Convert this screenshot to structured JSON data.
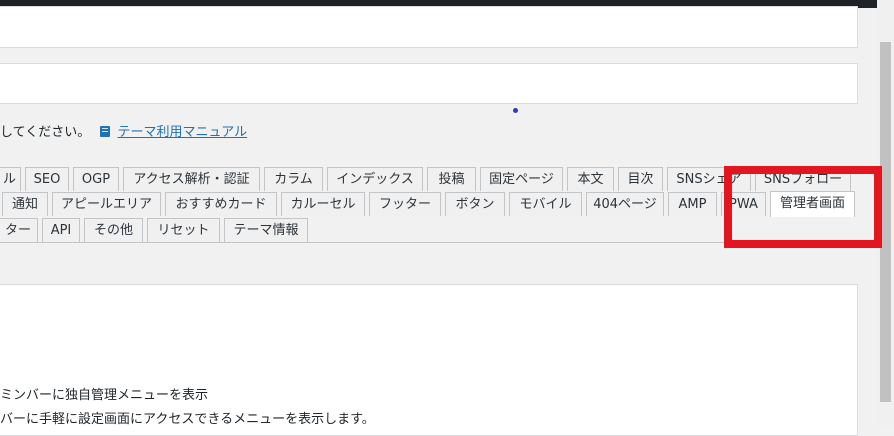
{
  "description": {
    "text": "してください。",
    "manual_link": "テーマ利用マニュアル"
  },
  "tabs": {
    "row1": [
      "ル",
      "SEO",
      "OGP",
      "アクセス解析・認証",
      "カラム",
      "インデックス",
      "投稿",
      "固定ページ",
      "本文",
      "目次",
      "SNSシェア",
      "SNSフォロー"
    ],
    "row2": [
      "通知",
      "アピールエリア",
      "おすすめカード",
      "カルーセル",
      "フッター",
      "ボタン",
      "モバイル",
      "404ページ",
      "AMP",
      "PWA",
      "管理者画面"
    ],
    "row3": [
      "ター",
      "API",
      "その他",
      "リセット",
      "テーマ情報"
    ],
    "active": "管理者画面"
  },
  "settings": {
    "option1": "ミンバーに独自管理メニューを表示",
    "option2": "バーに手軽に設定画面にアクセスできるメニューを表示します。"
  },
  "colors": {
    "highlight": "#e3161f",
    "link": "#2271b1",
    "topbar": "#1d2327"
  }
}
